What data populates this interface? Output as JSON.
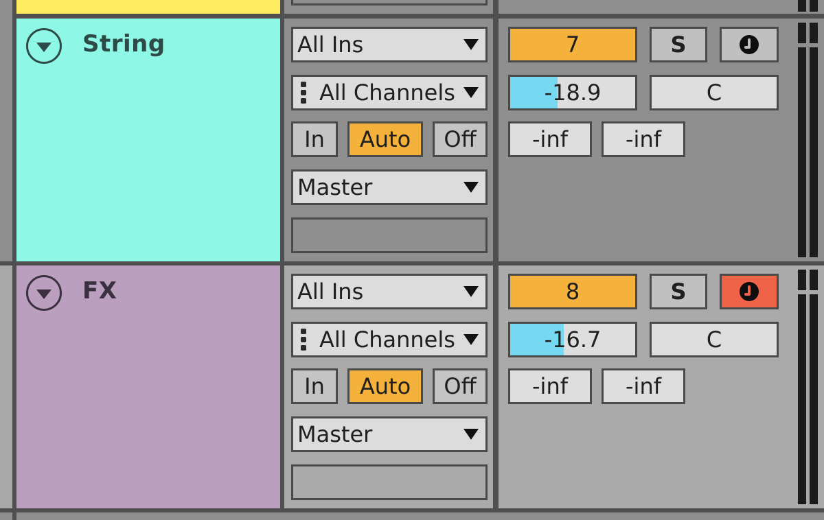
{
  "top_track": {
    "color": "#ffed5f"
  },
  "tracks": [
    {
      "name": "String",
      "color": "#8ef7e6",
      "name_color": "#2e4a47",
      "selected": false,
      "routing": {
        "input_type": "All Ins",
        "input_channel": "All Channels",
        "monitor": {
          "options": [
            "In",
            "Auto",
            "Off"
          ],
          "active": "Auto"
        },
        "output": "Master"
      },
      "mixer": {
        "track_number": "7",
        "solo_label": "S",
        "arm_active": false,
        "volume_db": "-18.9",
        "volume_fill_fraction": 0.38,
        "pan": "C",
        "peak_left": "-inf",
        "peak_right": "-inf"
      }
    },
    {
      "name": "FX",
      "color": "#bb9fbf",
      "name_color": "#3a3040",
      "selected": true,
      "routing": {
        "input_type": "All Ins",
        "input_channel": "All Channels",
        "monitor": {
          "options": [
            "In",
            "Auto",
            "Off"
          ],
          "active": "Auto"
        },
        "output": "Master"
      },
      "mixer": {
        "track_number": "8",
        "solo_label": "S",
        "arm_active": true,
        "volume_db": "-16.7",
        "volume_fill_fraction": 0.43,
        "pan": "C",
        "peak_left": "-inf",
        "peak_right": "-inf"
      }
    }
  ],
  "colors": {
    "panel_default": "#8f8f8f",
    "panel_selected": "#aaaaaa",
    "accent_orange": "#f4b13c",
    "arm_red": "#ef6449",
    "volume_blue": "#77d9f1"
  }
}
